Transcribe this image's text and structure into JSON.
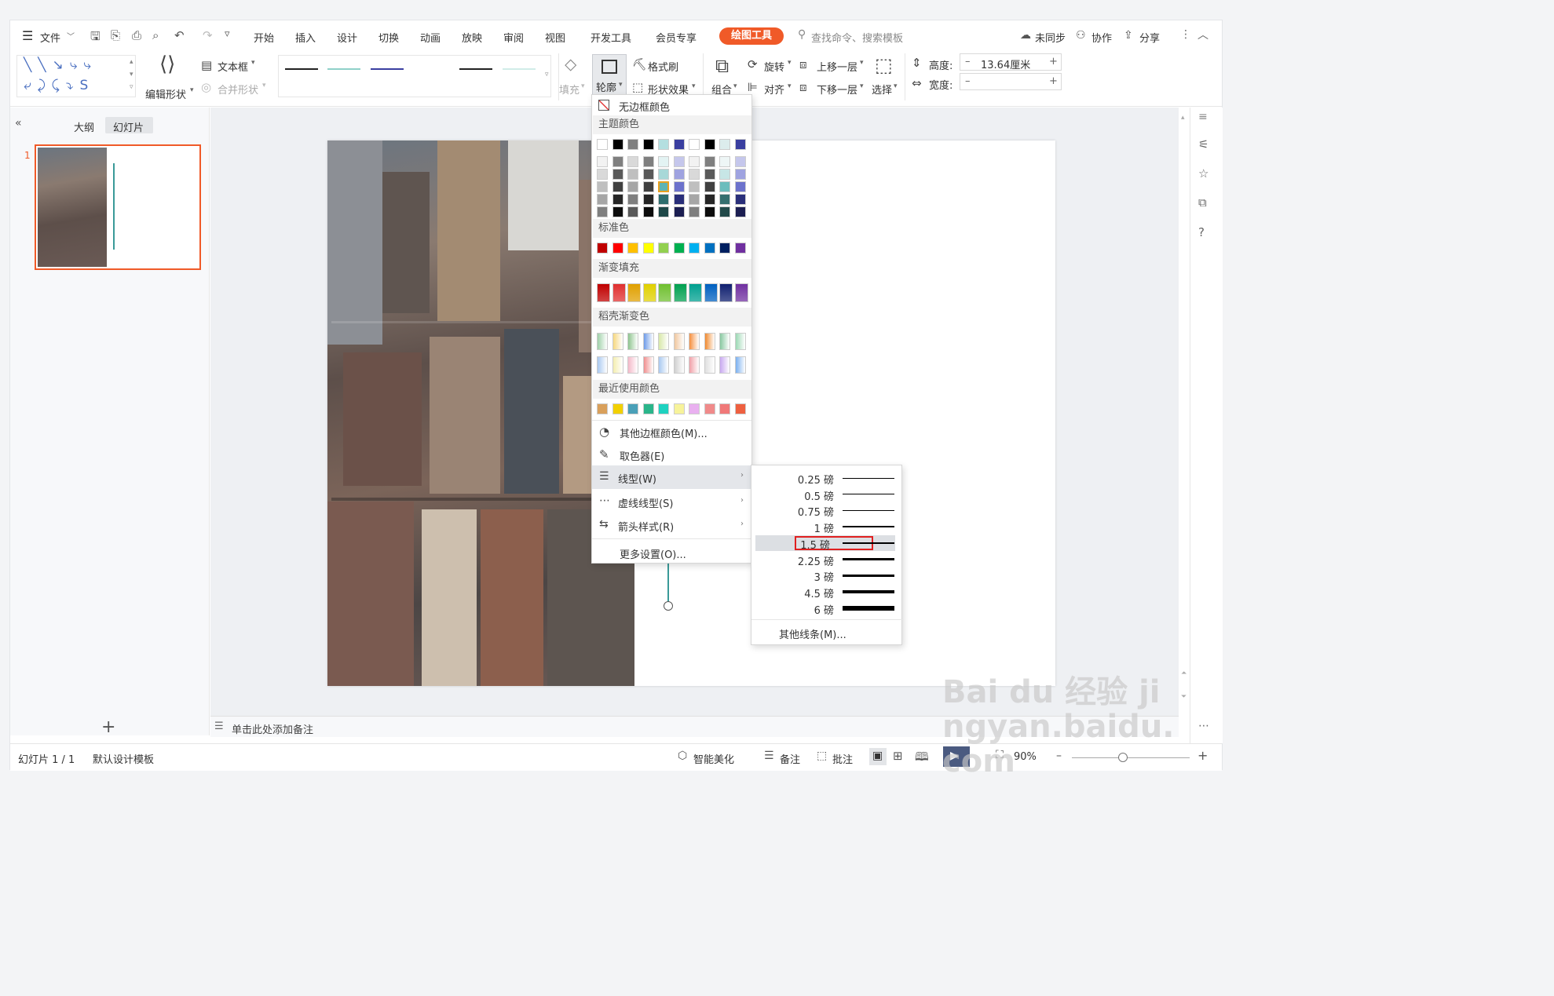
{
  "menu": {
    "file": "文件",
    "tabs": [
      "开始",
      "插入",
      "设计",
      "切换",
      "动画",
      "放映",
      "审阅",
      "视图",
      "开发工具",
      "会员专享"
    ],
    "active_tab": "绘图工具",
    "search_placeholder": "查找命令、搜索模板",
    "sync": "未同步",
    "collab": "协作",
    "share": "分享"
  },
  "ribbon": {
    "edit_shape": "编辑形状",
    "text_box": "文本框",
    "merge_shape": "合并形状",
    "fill": "填充",
    "outline": "轮廓",
    "format_painter": "格式刷",
    "shape_effect": "形状效果",
    "group": "组合",
    "rotate": "旋转",
    "align": "对齐",
    "bring_forward": "上移一层",
    "send_backward": "下移一层",
    "select": "选择",
    "height_label": "高度:",
    "height_value": "13.64厘米",
    "width_label": "宽度:",
    "width_value": ""
  },
  "left_panel": {
    "tab_outline": "大纲",
    "tab_slides": "幻灯片",
    "slide_number": "1",
    "add": "+"
  },
  "notes_placeholder": "单击此处添加备注",
  "status": {
    "slide_info": "幻灯片 1 / 1",
    "template": "默认设计模板",
    "smart": "智能美化",
    "notes": "备注",
    "comment": "批注",
    "zoom": "90%"
  },
  "dropdown": {
    "no_border": "无边框颜色",
    "theme_colors": "主题颜色",
    "standard_colors": "标准色",
    "gradient_fill": "渐变填充",
    "daoke_gradient": "稻壳渐变色",
    "recent_colors": "最近使用颜色",
    "more_colors": "其他边框颜色(M)...",
    "eyedropper": "取色器(E)",
    "line_type": "线型(W)",
    "dash_type": "虚线线型(S)",
    "arrow_style": "箭头样式(R)",
    "more_settings": "更多设置(O)...",
    "theme_top_row": [
      "#ffffff",
      "#000000",
      "#7f7f7f",
      "#000000",
      "#b4dfe0",
      "#3a3fa0",
      "#ffffff",
      "#000000",
      "#dcecec",
      "#3a3fa0"
    ],
    "standard_row": [
      "#c00000",
      "#ff0000",
      "#ffc000",
      "#ffff00",
      "#92d050",
      "#00b050",
      "#00b0f0",
      "#0070c0",
      "#002060",
      "#7030a0"
    ],
    "gradient_row": [
      "#c00000",
      "#e03030",
      "#e0a000",
      "#e0d000",
      "#70c030",
      "#00a050",
      "#00a090",
      "#0060c0",
      "#102070",
      "#7030a0"
    ],
    "recent_row": [
      "#d9a05b",
      "#f2d000",
      "#4aa0b8",
      "#2ab58a",
      "#1ed2c0",
      "#f7f39a",
      "#e9b0f0",
      "#f08a8a",
      "#f07878",
      "#ee6040"
    ]
  },
  "line_submenu": {
    "weights": [
      "0.25 磅",
      "0.5 磅",
      "0.75 磅",
      "1 磅",
      "1.5 磅",
      "2.25 磅",
      "3 磅",
      "4.5 磅",
      "6 磅"
    ],
    "selected": "1.5 磅",
    "more": "其他线条(M)..."
  },
  "watermark": "Bai du 经验 jingyan.baidu.com"
}
